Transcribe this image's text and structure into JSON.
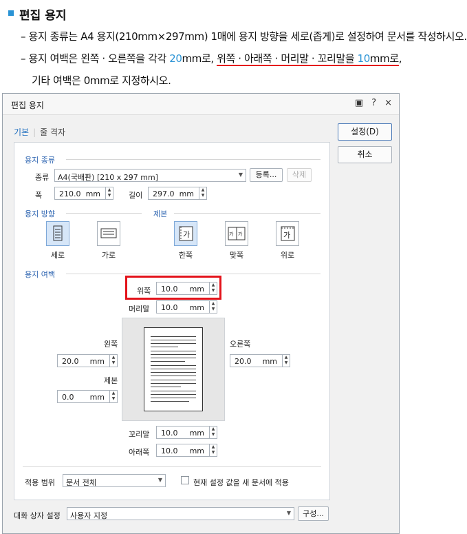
{
  "instructions": {
    "heading": "편집 용지",
    "line1": "– 용지 종류는 A4 용지(210mm×297mm) 1매에 용지 방향을 세로(좁게)로 설정하여 문서를 작성하시오.",
    "line2_pre": "– 용지 여백은 왼쪽 · 오른쪽을 각각 ",
    "line2_num1": "20",
    "line2_mid": "mm로, ",
    "line2_underlined_a": "위쪽 · 아래쪽 · 머리말 · 꼬리말을 ",
    "line2_num2": "10",
    "line2_underlined_b": "mm로",
    "line2_end": ",",
    "line3": "기타 여백은 0mm로 지정하시오.",
    "accent_color": "#2a93d5",
    "highlight_color": "#e5121a"
  },
  "dialog": {
    "title": "편집 용지",
    "title_icons": [
      "restore-icon",
      "help-icon",
      "close-icon"
    ],
    "title_glyphs": [
      "▣",
      "?",
      "×"
    ],
    "tabs": [
      {
        "label": "기본",
        "active": true
      },
      {
        "label": "줄 격자",
        "active": false
      }
    ],
    "buttons": {
      "ok": "설정(D)",
      "cancel": "취소",
      "register": "등록...",
      "delete": "삭제",
      "compose": "구성..."
    },
    "paper_type": {
      "section": "용지 종류",
      "kind_label": "종류",
      "kind_value": "A4(국배판)  [210 x 297 mm]",
      "width_label": "폭",
      "width_value": "210.0",
      "length_label": "길이",
      "length_value": "297.0",
      "unit": "mm"
    },
    "orientation": {
      "section": "용지 방향",
      "options": [
        {
          "label": "세로",
          "selected": true
        },
        {
          "label": "가로",
          "selected": false
        }
      ]
    },
    "binding": {
      "section": "제본",
      "options": [
        {
          "label": "한쪽",
          "selected": true
        },
        {
          "label": "맞쪽",
          "selected": false
        },
        {
          "label": "위로",
          "selected": false
        }
      ],
      "glyph": "가"
    },
    "margins": {
      "section": "용지 여백",
      "top_label": "위쪽",
      "top_value": "10.0",
      "header_label": "머리말",
      "header_value": "10.0",
      "left_label": "왼쪽",
      "left_value": "20.0",
      "right_label": "오른쪽",
      "right_value": "20.0",
      "gutter_label": "제본",
      "gutter_value": "0.0",
      "footer_label": "꼬리말",
      "footer_value": "10.0",
      "bottom_label": "아래쪽",
      "bottom_value": "10.0",
      "unit": "mm"
    },
    "apply": {
      "label": "적용 범위",
      "value": "문서 전체",
      "checkbox_label": "현재 설정 값을 새 문서에 적용",
      "checked": false
    },
    "dialog_setting": {
      "label": "대화 상자 설정",
      "value": "사용자 지정"
    }
  }
}
